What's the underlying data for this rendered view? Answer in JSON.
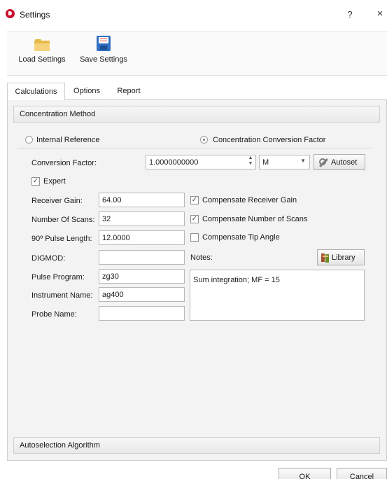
{
  "window": {
    "title": "Settings",
    "help": "?",
    "close": "×"
  },
  "toolbar": {
    "load_label": "Load Settings",
    "save_label": "Save Settings"
  },
  "tabs": [
    "Calculations",
    "Options",
    "Report"
  ],
  "sections": {
    "concentration": "Concentration Method",
    "autoselection": "Autoselection Algorithm"
  },
  "method": {
    "internal_reference": "Internal Reference",
    "conversion_factor_option": "Concentration Conversion Factor",
    "selected": "Concentration Conversion Factor"
  },
  "conversion": {
    "label": "Conversion Factor:",
    "value": "1.0000000000",
    "unit": "M",
    "autoset": "Autoset"
  },
  "expert": {
    "label": "Expert",
    "checked": true
  },
  "fields": {
    "receiver_gain": {
      "label": "Receiver Gain:",
      "value": "64.00"
    },
    "number_of_scans": {
      "label": "Number Of Scans:",
      "value": "32"
    },
    "pulse_length": {
      "label": "90º Pulse Length:",
      "value": "12.0000"
    },
    "digmod": {
      "label": "DIGMOD:",
      "value": ""
    },
    "pulse_program": {
      "label": "Pulse Program:",
      "value": "zg30"
    },
    "instrument_name": {
      "label": "Instrument Name:",
      "value": "ag400"
    },
    "probe_name": {
      "label": "Probe Name:",
      "value": ""
    }
  },
  "compensate": {
    "receiver_gain": {
      "label": "Compensate Receiver Gain",
      "checked": true
    },
    "number_of_scans": {
      "label": "Compensate Number of Scans",
      "checked": true
    },
    "tip_angle": {
      "label": "Compensate Tip Angle",
      "checked": false
    }
  },
  "notes": {
    "label": "Notes:",
    "value": "Sum integration; MF = 15",
    "library": "Library"
  },
  "footer": {
    "ok": "OK",
    "cancel": "Cancel"
  }
}
